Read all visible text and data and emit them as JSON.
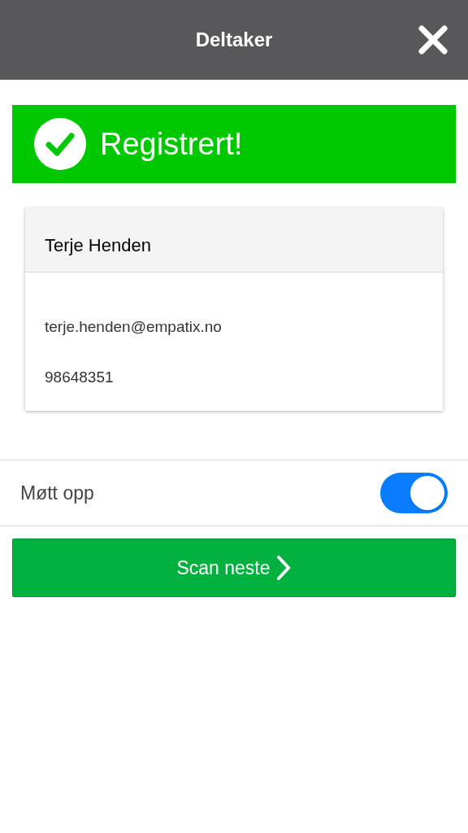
{
  "header": {
    "title": "Deltaker"
  },
  "banner": {
    "text": "Registrert!"
  },
  "participant": {
    "name": "Terje Henden",
    "email": "terje.henden@empatix.no",
    "phone": "98648351"
  },
  "attendance": {
    "label": "Møtt opp",
    "on": true
  },
  "next_button": {
    "label": "Scan neste"
  }
}
